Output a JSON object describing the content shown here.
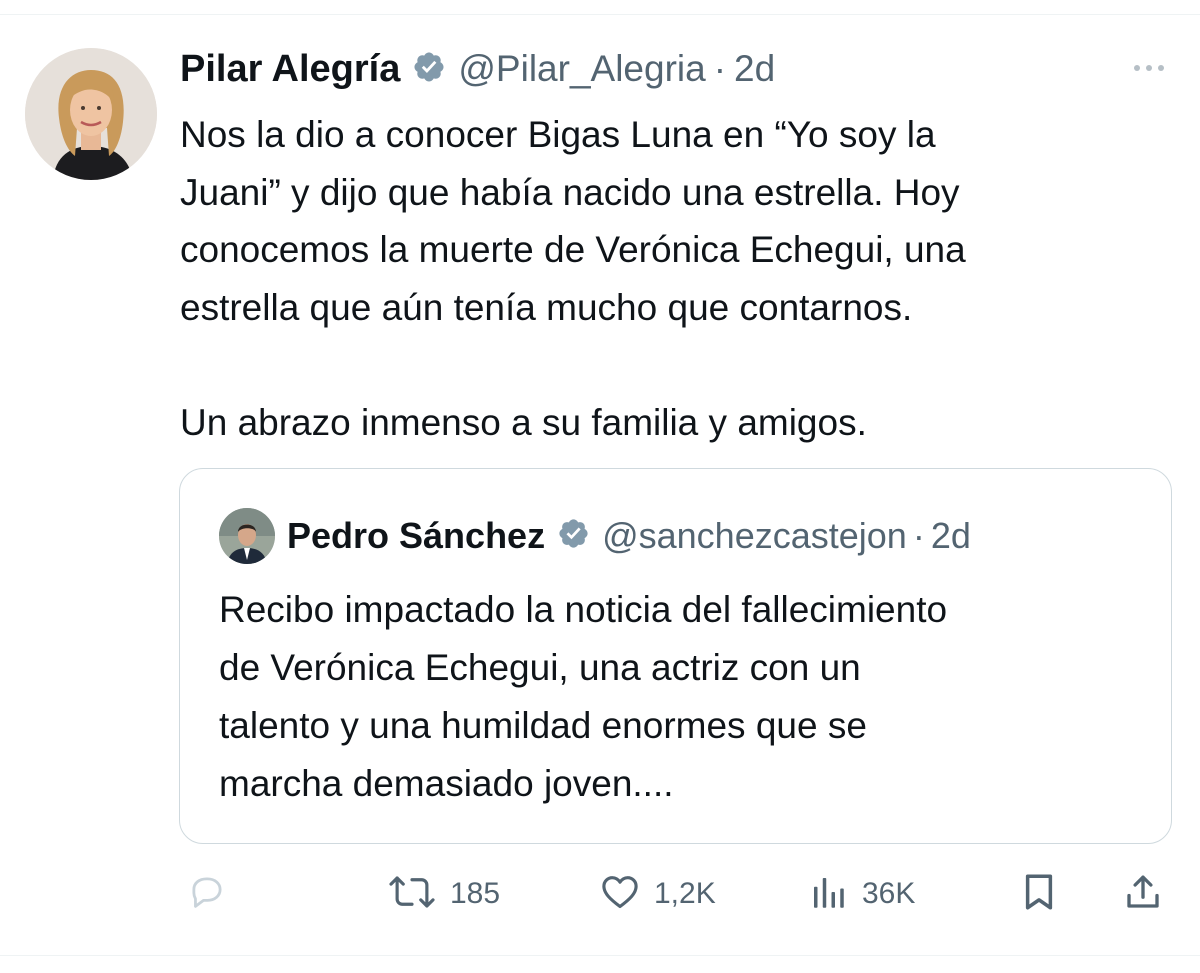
{
  "tweet": {
    "author_name": "Pilar Alegría",
    "handle": "@Pilar_Alegria",
    "separator": "·",
    "time": "2d",
    "text": "Nos la dio a conocer Bigas Luna en “Yo soy la\nJuani” y dijo que había nacido una estrella. Hoy\nconocemos la muerte de Verónica Echegui, una\nestrella que aún tenía mucho que contarnos.\n\nUn abrazo inmenso a su familia y amigos."
  },
  "quoted_tweet": {
    "author_name": "Pedro Sánchez",
    "handle": "@sanchezcastejon",
    "separator": "·",
    "time": "2d",
    "text": "Recibo impactado la noticia del fallecimiento\nde Verónica Echegui, una actriz con un\ntalento y una humildad enormes que se\nmarcha demasiado joven...."
  },
  "actions": {
    "reply_icon": "reply-icon",
    "retweet_icon": "retweet-icon",
    "retweet_count": "185",
    "like_icon": "heart-icon",
    "like_count": "1,2K",
    "views_icon": "views-icon",
    "views_count": "36K",
    "bookmark_icon": "bookmark-icon",
    "share_icon": "share-icon"
  },
  "colors": {
    "text": "#0f1419",
    "secondary": "#536471",
    "verified_badge": "#829aab",
    "border": "#cfd9de"
  }
}
